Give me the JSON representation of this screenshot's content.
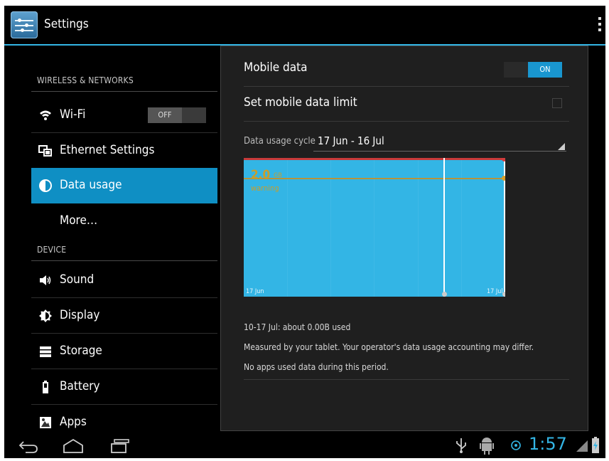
{
  "app": {
    "title": "Settings"
  },
  "sidebar": {
    "sections": [
      {
        "label": "WIRELESS & NETWORKS"
      },
      {
        "label": "DEVICE"
      }
    ],
    "items": [
      {
        "label": "Wi-Fi",
        "icon": "wifi-icon",
        "toggle": "OFF"
      },
      {
        "label": "Ethernet Settings",
        "icon": "ethernet-icon"
      },
      {
        "label": "Data usage",
        "icon": "data-usage-icon",
        "active": true
      },
      {
        "label": "More…"
      },
      {
        "label": "Sound",
        "icon": "speaker-icon"
      },
      {
        "label": "Display",
        "icon": "brightness-icon"
      },
      {
        "label": "Storage",
        "icon": "storage-icon"
      },
      {
        "label": "Battery",
        "icon": "battery-icon"
      },
      {
        "label": "Apps",
        "icon": "apps-icon"
      }
    ]
  },
  "main": {
    "mobile_data": {
      "label": "Mobile data",
      "toggle": "ON"
    },
    "data_limit": {
      "label": "Set mobile data limit",
      "checked": false
    },
    "cycle": {
      "label": "Data usage cycle",
      "value": "17 Jun - 16 Jul"
    },
    "chart": {
      "warning_value": "2.0",
      "warning_unit": "GB",
      "warning_label": "warning",
      "start_label": "17 Jun",
      "end_label": "17 Jul"
    },
    "usage_summary": "10-17 Jul: about 0.00B used",
    "measured_note": "Measured by your tablet. Your operator's data usage accounting may differ.",
    "no_apps_note": "No apps used data during this period."
  },
  "status": {
    "time": "1:57"
  },
  "colors": {
    "accent": "#33b5e5",
    "limit": "#c83a3a",
    "warning": "#c99e2a"
  }
}
